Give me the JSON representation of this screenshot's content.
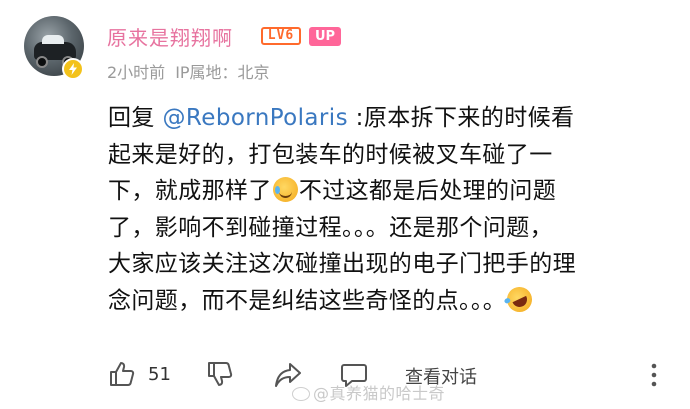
{
  "user": {
    "name": "原来是翔翔啊",
    "level_badge": "LV6",
    "up_badge": "UP",
    "time": "2小时前",
    "ip_location": "IP属地：北京",
    "avatar_icon": "racing-car-avatar",
    "verified_icon": "lightning-verify-icon"
  },
  "comment": {
    "reply_prefix": "回复 ",
    "mention": "@RebornPolaris",
    "line1_rest": " :原本拆下来的时候看",
    "line2": "起来是好的，打包装车的时候被叉车碰了一",
    "line3a": "下，就成那样了",
    "line3b": "不过这都是后处理的问题",
    "line4": "了，影响不到碰撞过程。。。还是那个问题，",
    "line5": "大家应该关注这次碰撞出现的电子门把手的理",
    "line6": "念问题，而不是纠结这些奇怪的点。。。"
  },
  "actions": {
    "like_count": "51",
    "view_conversation": "查看对话"
  },
  "watermark": "@真养猫的哈士奇",
  "colors": {
    "username": "#e7739f",
    "level": "#ff6a2c",
    "up_badge": "#ff6699",
    "mention": "#3a78c0",
    "meta": "#9a9a9a"
  }
}
